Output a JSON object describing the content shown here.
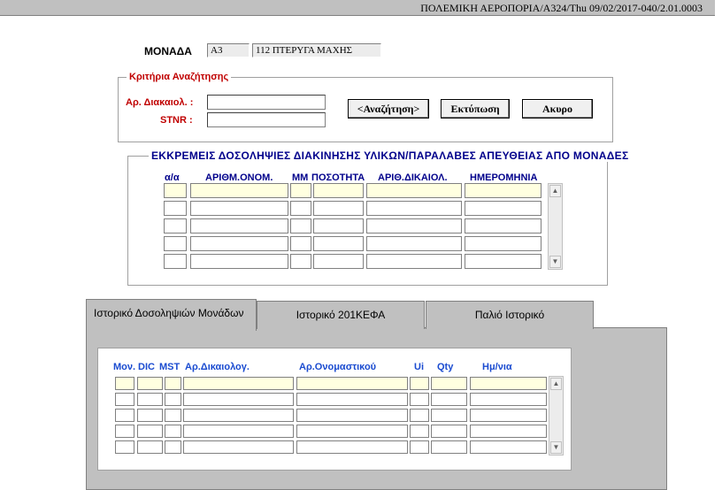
{
  "title_bar": "ΠΟΛΕΜΙΚΗ ΑΕΡΟΠΟΡΙΑ/A324/Thu 09/02/2017-040/2.01.0003",
  "unit": {
    "label": "ΜΟΝΑΔΑ",
    "code": "A3",
    "name": "112 ΠΤΕΡΥΓΑ ΜΑΧΗΣ"
  },
  "search": {
    "title": "Κριτήρια Αναζήτησης",
    "doc_label": "Αρ. Διακαιολ. :",
    "stnr_label": "STNR :",
    "search_btn": "<Αναζήτηση>",
    "print_btn": "Εκτύπωση",
    "cancel_btn": "Ακυρο"
  },
  "pending": {
    "title": "ΕΚΚΡΕΜΕΙΣ ΔΟΣΟΛΗΨΙΕΣ ΔΙΑΚΙΝΗΣΗΣ ΥΛΙΚΩΝ/ΠΑΡΑΛΑΒΕΣ ΑΠΕΥΘΕΙΑΣ ΑΠΟ ΜΟΝΑΔΕΣ",
    "columns": [
      "α/α",
      "ΑΡΙΘΜ.ΟΝΟΜ.",
      "ΜΜ",
      "ΠΟΣΟΤΗΤΑ",
      "ΑΡΙΘ.ΔΙΚΑΙΟΛ.",
      "ΗΜΕΡΟΜΗΝΙΑ"
    ]
  },
  "tabs": [
    "Ιστορικό Δοσοληψιών Μονάδων",
    "Ιστορικό 201ΚΕΦΑ",
    "Παλιό Ιστορικό"
  ],
  "history": {
    "columns": [
      "Μον.",
      "DIC",
      "MST",
      "Αρ.Δικαιολογ.",
      "Αρ.Ονομαστικού",
      "Ui",
      "Qty",
      "Ημ/νια"
    ]
  },
  "colors": {
    "group_title_red": "#c00000",
    "column_header_blue": "#00008b",
    "highlight_row": "#ffffe0"
  }
}
